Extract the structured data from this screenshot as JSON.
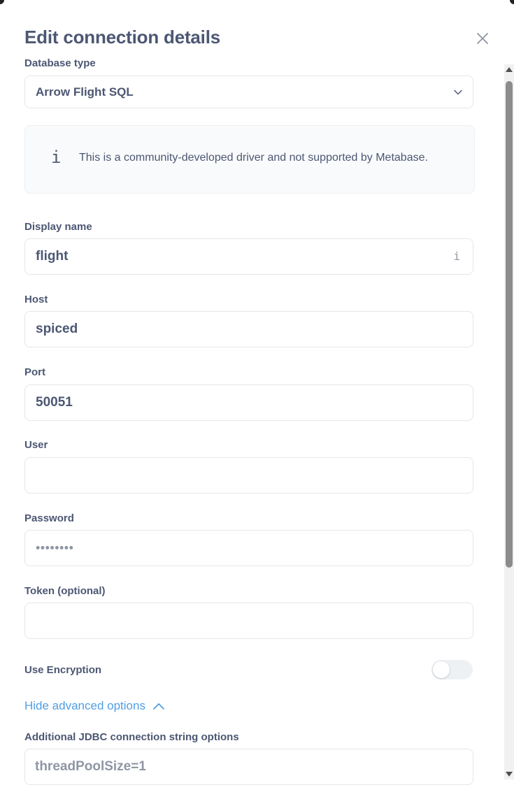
{
  "modal": {
    "title": "Edit connection details",
    "close_icon": "close-icon"
  },
  "database_type": {
    "label": "Database type",
    "value": "Arrow Flight SQL",
    "icon": "chevron-down-icon"
  },
  "notice": {
    "icon": "info-icon",
    "text": "This is a community-developed driver and not supported by Metabase."
  },
  "fields": {
    "display_name": {
      "label": "Display name",
      "value": "flight",
      "icon": "info-icon"
    },
    "host": {
      "label": "Host",
      "value": "spiced"
    },
    "port": {
      "label": "Port",
      "value": "50051"
    },
    "user": {
      "label": "User",
      "value": ""
    },
    "password": {
      "label": "Password",
      "masked": "••••••••"
    },
    "token": {
      "label": "Token (optional)",
      "value": ""
    }
  },
  "encryption": {
    "label": "Use Encryption",
    "enabled": false
  },
  "advanced": {
    "toggle_label": "Hide advanced options",
    "icon": "chevron-up-icon",
    "jdbc_label": "Additional JDBC connection string options",
    "jdbc_placeholder": "threadPoolSize=1"
  },
  "colors": {
    "text": "#4c5773",
    "muted": "#8f96a3",
    "link": "#509ee3",
    "border": "#e3e6ea"
  }
}
